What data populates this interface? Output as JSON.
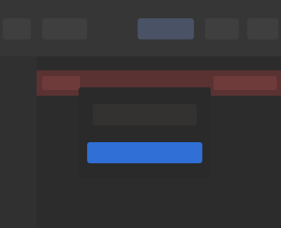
{
  "theme": {
    "background": "#2c2c2c",
    "toolbar": "#363636",
    "alert": "#5a3232",
    "accent": "#2f6fd6"
  },
  "toolbar": {
    "items": [
      {
        "name": "toolbar-item-1"
      },
      {
        "name": "toolbar-item-2"
      },
      {
        "name": "toolbar-item-3",
        "active": true
      },
      {
        "name": "toolbar-item-4"
      },
      {
        "name": "toolbar-item-5"
      }
    ]
  }
}
